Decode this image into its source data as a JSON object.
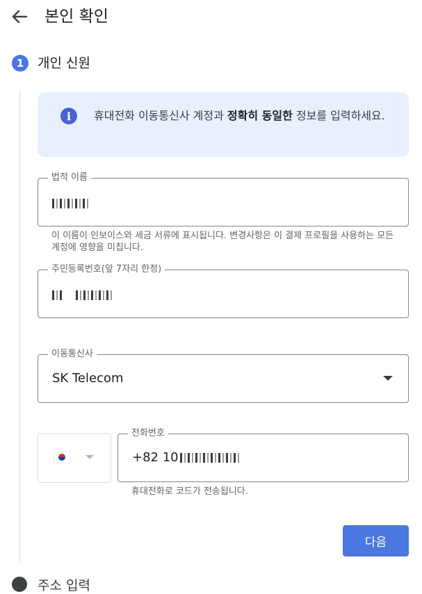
{
  "header": {
    "title": "본인 확인",
    "back_icon": "arrow-back-icon"
  },
  "step": {
    "number": "1",
    "label": "개인 신원",
    "next_label": "주소 입력"
  },
  "info": {
    "icon": "info-icon",
    "text_before": "휴대전화 이동통신사 계정과 ",
    "text_bold": "정확히 동일한",
    "text_after": " 정보를 입력하세요."
  },
  "legal_name": {
    "label": "법적 이름",
    "value": "",
    "helper": "이 이름이 인보이스와 세금 서류에 표시됩니다. 변경사항은 이 결제 프로필을 사용하는 모든 계정에 영향을 미칩니다."
  },
  "resident_id": {
    "label": "주민등록번호(앞 7자리 한정)",
    "value": ""
  },
  "carrier": {
    "label": "이동통신사",
    "value": "SK Telecom",
    "caret_icon": "dropdown-caret-icon"
  },
  "phone": {
    "country_flag": "korea-flag-icon",
    "label": "전화번호",
    "value_prefix": "+82 10",
    "helper": "휴대전화로 코드가 전송됩니다."
  },
  "next_button": {
    "label": "다음"
  },
  "colors": {
    "primary": "#4a77e0",
    "info_bg": "#e8f0fe",
    "border": "#80868b"
  }
}
